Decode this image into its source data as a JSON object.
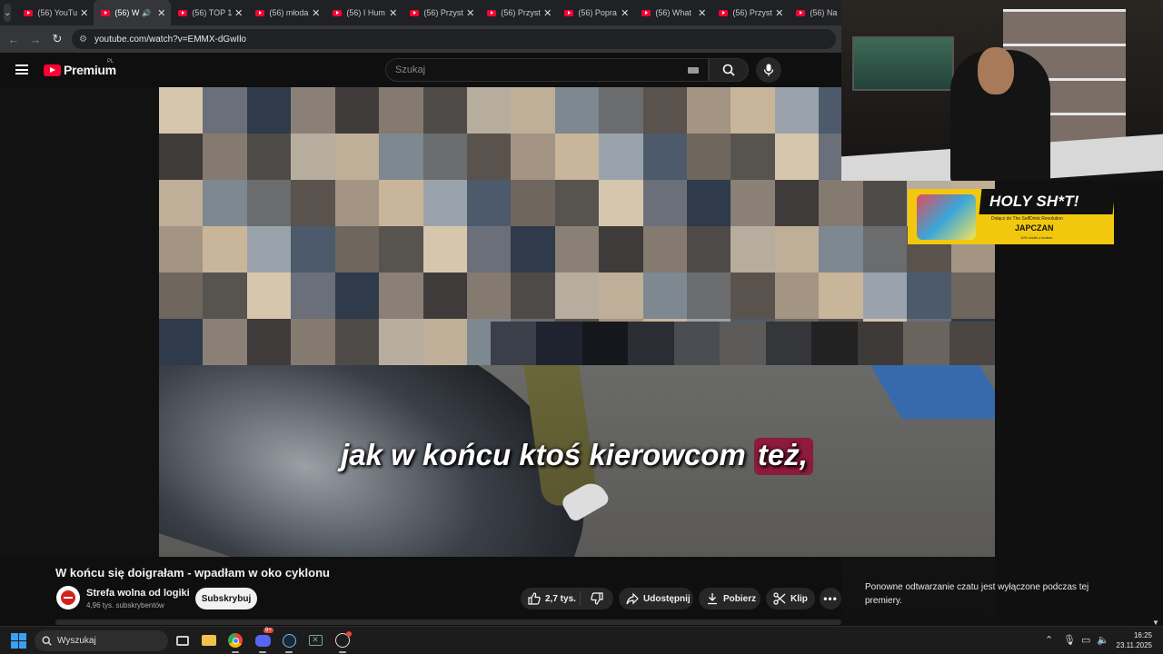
{
  "browser": {
    "tabs": [
      {
        "title": "(56) YouTu",
        "active": false
      },
      {
        "title": "(56) W",
        "active": true,
        "audio": true
      },
      {
        "title": "(56) TOP 1",
        "active": false
      },
      {
        "title": "(56) młoda",
        "active": false
      },
      {
        "title": "(56) I Hum",
        "active": false
      },
      {
        "title": "(56) Przyst",
        "active": false
      },
      {
        "title": "(56) Przyst",
        "active": false
      },
      {
        "title": "(56) Popra",
        "active": false
      },
      {
        "title": "(56) What",
        "active": false
      },
      {
        "title": "(56) Przyst",
        "active": false
      },
      {
        "title": "(56) Na",
        "active": false
      }
    ],
    "url": "youtube.com/watch?v=EMMX-dGwIlo"
  },
  "youtube": {
    "logo_text": "Premium",
    "region": "PL",
    "search_placeholder": "Szukaj"
  },
  "video": {
    "subtitle_main": "jak w końcu ktoś kierowcom",
    "subtitle_highlight": "też,",
    "title": "W końcu się doigrałam - wpadłam w oko cyklonu",
    "channel_name": "Strefa wolna od logiki",
    "subscribers": "4,96 tys. subskrybentów",
    "subscribe_label": "Subskrybuj",
    "like_count": "2,7 tys.",
    "share_label": "Udostępnij",
    "download_label": "Pobierz",
    "clip_label": "Klip"
  },
  "chat": {
    "message": "Ponowne odtwarzanie czatu jest wyłączone podczas tej premiery."
  },
  "overlay_ad": {
    "headline": "HOLY SH*T!",
    "line1": "Dołącz do The SelfDrink Revolution",
    "brand": "JAPCZAN",
    "line2": "10% zniżki z kodem"
  },
  "taskbar": {
    "search_label": "Wyszukaj",
    "time": "16:25",
    "date": "23.11.2025",
    "discord_badge": "9+"
  },
  "colors": {
    "youtube_red": "#ff0033",
    "subtitle_highlight": "#8c1b3c",
    "ad_yellow": "#f2c80f"
  }
}
